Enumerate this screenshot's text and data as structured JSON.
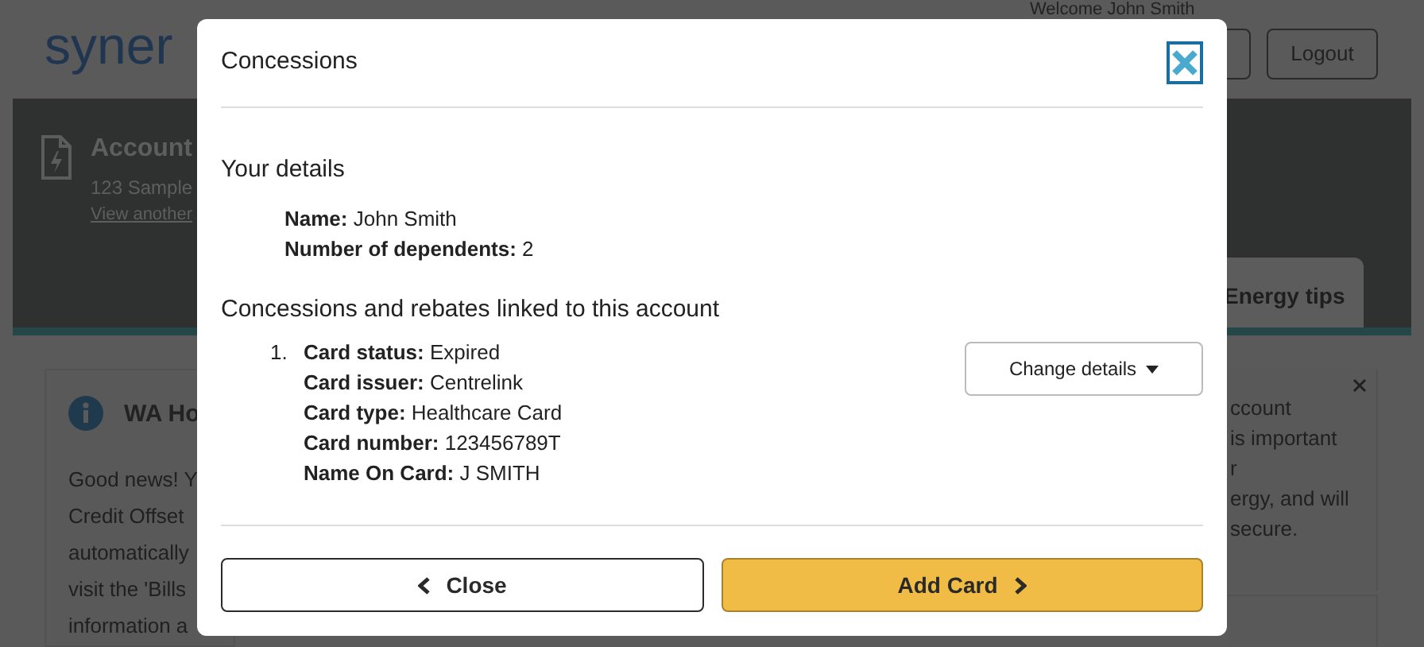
{
  "background": {
    "logo": "syner",
    "welcome": "Welcome John Smith",
    "logout": "Logout",
    "account_title": "Account",
    "address": "123 Sample",
    "account_link": "View another",
    "tab": "Energy tips",
    "notice_title": "WA Ho",
    "notice_lines": [
      "Good news! Y",
      "Credit Offset",
      "automatically",
      "visit the 'Bills",
      "information a"
    ],
    "right_lines": [
      "ccount",
      "is important",
      "r",
      "ergy, and will",
      "secure."
    ]
  },
  "dialog": {
    "title": "Concessions",
    "details_heading": "Your details",
    "details": [
      {
        "label": "Name:",
        "value": "John Smith"
      },
      {
        "label": "Number of dependents:",
        "value": "2"
      }
    ],
    "cards_heading": "Concessions and rebates linked to this account",
    "cards": [
      {
        "number": "1.",
        "action": "Change details",
        "fields": [
          {
            "label": "Card status:",
            "value": "Expired"
          },
          {
            "label": "Card issuer:",
            "value": "Centrelink"
          },
          {
            "label": "Card type:",
            "value": "Healthcare Card"
          },
          {
            "label": "Card number:",
            "value": "123456789T"
          },
          {
            "label": "Name On Card:",
            "value": "J SMITH"
          }
        ]
      }
    ],
    "buttons": [
      {
        "kind": "secondary",
        "label": "Close"
      },
      {
        "kind": "primary",
        "label": "Add Card"
      }
    ]
  }
}
